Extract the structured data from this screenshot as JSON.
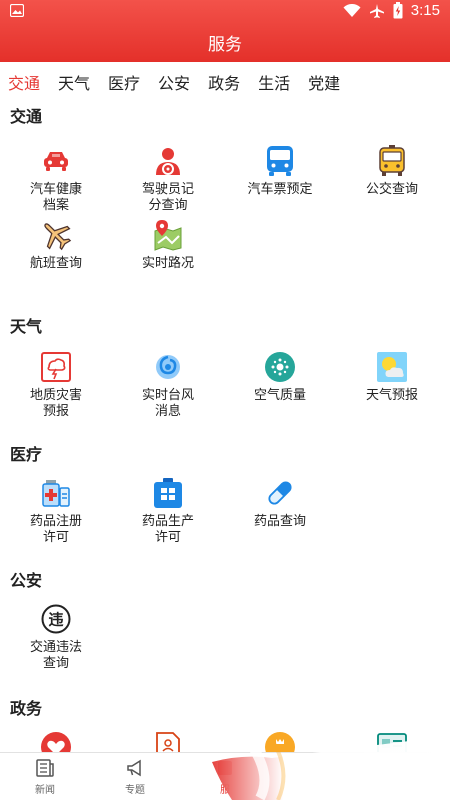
{
  "status_bar": {
    "time": "3:15"
  },
  "header": {
    "title": "服务"
  },
  "tabs": [
    {
      "label": "交通",
      "active": true
    },
    {
      "label": "天气"
    },
    {
      "label": "医疗"
    },
    {
      "label": "公安"
    },
    {
      "label": "政务"
    },
    {
      "label": "生活"
    },
    {
      "label": "党建"
    }
  ],
  "sections": {
    "traffic": {
      "title": "交通",
      "items": [
        {
          "label": "汽车健康\n档案",
          "icon": "car-icon"
        },
        {
          "label": "驾驶员记\n分查询",
          "icon": "driver-icon"
        },
        {
          "label": "汽车票预定",
          "icon": "bus-icon"
        },
        {
          "label": "公交查询",
          "icon": "bus-card-icon"
        },
        {
          "label": "航班查询",
          "icon": "airplane-icon"
        },
        {
          "label": "实时路况",
          "icon": "map-pin-icon"
        }
      ]
    },
    "weather": {
      "title": "天气",
      "items": [
        {
          "label": "地质灾害\n预报",
          "icon": "hazard-icon"
        },
        {
          "label": "实时台风\n消息",
          "icon": "typhoon-icon"
        },
        {
          "label": "空气质量",
          "icon": "air-quality-icon"
        },
        {
          "label": "天气预报",
          "icon": "weather-icon"
        }
      ]
    },
    "medical": {
      "title": "医疗",
      "items": [
        {
          "label": "药品注册\n许可",
          "icon": "medicine-register-icon"
        },
        {
          "label": "药品生产\n许可",
          "icon": "medicine-production-icon"
        },
        {
          "label": "药品查询",
          "icon": "pill-icon"
        }
      ]
    },
    "police": {
      "title": "公安",
      "items": [
        {
          "label": "交通违法\n查询",
          "icon": "violation-icon"
        }
      ]
    },
    "government": {
      "title": "政务"
    }
  },
  "bottom_nav": [
    {
      "label": "新闻",
      "icon": "news-icon"
    },
    {
      "label": "专题",
      "icon": "megaphone-icon"
    },
    {
      "label": "服",
      "icon": "service-icon"
    }
  ],
  "colors": {
    "brand_red": "#e53935",
    "header_red": "#ef4b44"
  }
}
